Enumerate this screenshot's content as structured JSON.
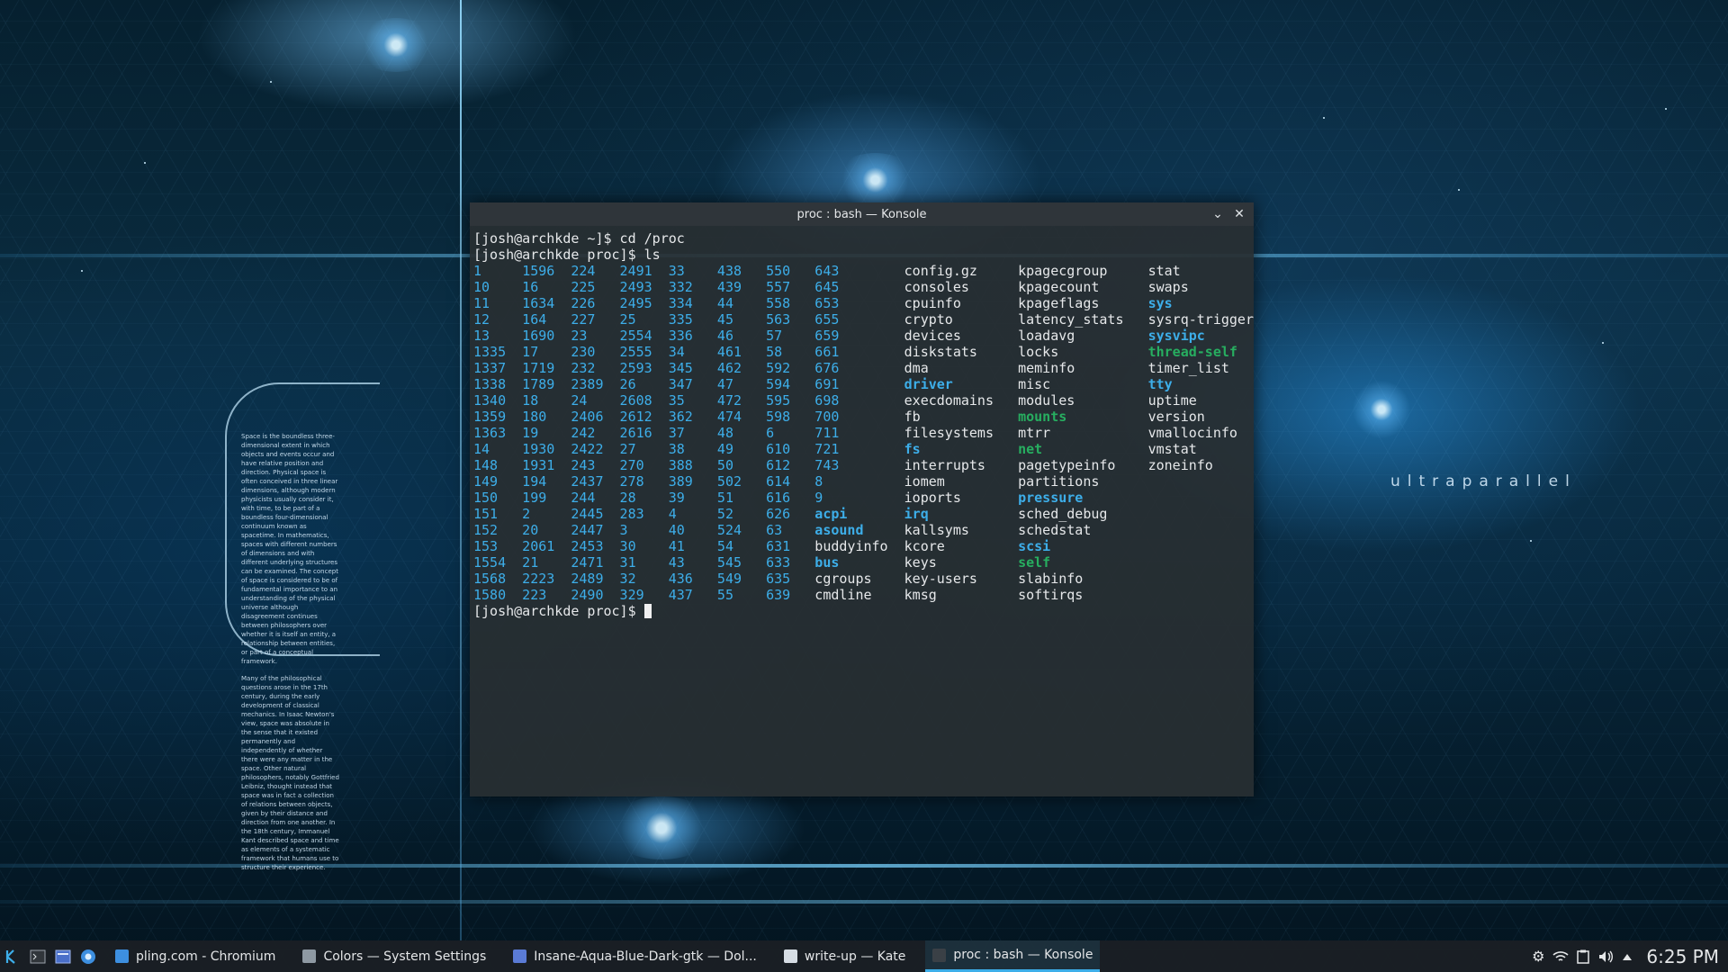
{
  "wallpaper": {
    "brand_text": "ultraparallel",
    "panel_paragraphs": [
      "Space is the boundless three-dimensional extent in which objects and events occur and have relative position and direction. Physical space is often conceived in three linear dimensions, although modern physicists usually consider it, with time, to be part of a boundless four-dimensional continuum known as spacetime. In mathematics, spaces with different numbers of dimensions and with different underlying structures can be examined. The concept of space is considered to be of fundamental importance to an understanding of the physical universe although disagreement continues between philosophers over whether it is itself an entity, a relationship between entities, or part of a conceptual framework.",
      "Many of the philosophical questions arose in the 17th century, during the early development of classical mechanics. In Isaac Newton's view, space was absolute in the sense that it existed permanently and independently of whether there were any matter in the space. Other natural philosophers, notably Gottfried Leibniz, thought instead that space was in fact a collection of relations between objects, given by their distance and direction from one another. In the 18th century, Immanuel Kant described space and time as elements of a systematic framework that humans use to structure their experience."
    ]
  },
  "konsole": {
    "title": "proc : bash — Konsole",
    "minimize_glyph": "⌄",
    "close_glyph": "✕",
    "lines": [
      [
        {
          "t": "[josh@archkde ~]$ cd /proc",
          "c": ""
        }
      ],
      [
        {
          "t": "[josh@archkde proc]$ ls",
          "c": ""
        }
      ],
      [
        {
          "t": "1     ",
          "c": "num"
        },
        {
          "t": "1596  224   2491  33    438   550   643        ",
          "c": "num"
        },
        {
          "t": "config.gz     ",
          "c": ""
        },
        {
          "t": "kpagecgroup     ",
          "c": ""
        },
        {
          "t": "stat",
          "c": ""
        }
      ],
      [
        {
          "t": "10    16    225   2493  332   439   557   645        ",
          "c": "num"
        },
        {
          "t": "consoles      ",
          "c": ""
        },
        {
          "t": "kpagecount      ",
          "c": ""
        },
        {
          "t": "swaps",
          "c": ""
        }
      ],
      [
        {
          "t": "11    1634  226   2495  334   44    558   653        ",
          "c": "num"
        },
        {
          "t": "cpuinfo       ",
          "c": ""
        },
        {
          "t": "kpageflags      ",
          "c": ""
        },
        {
          "t": "sys",
          "c": "dir"
        }
      ],
      [
        {
          "t": "12    164   227   25    335   45    563   655        ",
          "c": "num"
        },
        {
          "t": "crypto        ",
          "c": ""
        },
        {
          "t": "latency_stats   ",
          "c": ""
        },
        {
          "t": "sysrq-trigger",
          "c": ""
        }
      ],
      [
        {
          "t": "13    1690  23    2554  336   46    57    659        ",
          "c": "num"
        },
        {
          "t": "devices       ",
          "c": ""
        },
        {
          "t": "loadavg         ",
          "c": ""
        },
        {
          "t": "sysvipc",
          "c": "dir"
        }
      ],
      [
        {
          "t": "1335  17    230   2555  34    461   58    661        ",
          "c": "num"
        },
        {
          "t": "diskstats     ",
          "c": ""
        },
        {
          "t": "locks           ",
          "c": ""
        },
        {
          "t": "thread-self",
          "c": "lnk"
        }
      ],
      [
        {
          "t": "1337  1719  232   2593  345   462   592   676        ",
          "c": "num"
        },
        {
          "t": "dma           ",
          "c": ""
        },
        {
          "t": "meminfo         ",
          "c": ""
        },
        {
          "t": "timer_list",
          "c": ""
        }
      ],
      [
        {
          "t": "1338  1789  2389  26    347   47    594   691        ",
          "c": "num"
        },
        {
          "t": "driver",
          "c": "dir"
        },
        {
          "t": "        ",
          "c": ""
        },
        {
          "t": "misc            ",
          "c": ""
        },
        {
          "t": "tty",
          "c": "dir"
        }
      ],
      [
        {
          "t": "1340  18    24    2608  35    472   595   698        ",
          "c": "num"
        },
        {
          "t": "execdomains   ",
          "c": ""
        },
        {
          "t": "modules         ",
          "c": ""
        },
        {
          "t": "uptime",
          "c": ""
        }
      ],
      [
        {
          "t": "1359  180   2406  2612  362   474   598   700        ",
          "c": "num"
        },
        {
          "t": "fb            ",
          "c": ""
        },
        {
          "t": "mounts",
          "c": "lnk"
        },
        {
          "t": "          ",
          "c": ""
        },
        {
          "t": "version",
          "c": ""
        }
      ],
      [
        {
          "t": "1363  19    242   2616  37    48    6     711        ",
          "c": "num"
        },
        {
          "t": "filesystems   ",
          "c": ""
        },
        {
          "t": "mtrr            ",
          "c": ""
        },
        {
          "t": "vmallocinfo",
          "c": ""
        }
      ],
      [
        {
          "t": "14    1930  2422  27    38    49    610   721        ",
          "c": "num"
        },
        {
          "t": "fs",
          "c": "dir"
        },
        {
          "t": "            ",
          "c": ""
        },
        {
          "t": "net",
          "c": "lnk"
        },
        {
          "t": "             ",
          "c": ""
        },
        {
          "t": "vmstat",
          "c": ""
        }
      ],
      [
        {
          "t": "148   1931  243   270   388   50    612   743        ",
          "c": "num"
        },
        {
          "t": "interrupts    ",
          "c": ""
        },
        {
          "t": "pagetypeinfo    ",
          "c": ""
        },
        {
          "t": "zoneinfo",
          "c": ""
        }
      ],
      [
        {
          "t": "149   194   2437  278   389   502   614   8          ",
          "c": "num"
        },
        {
          "t": "iomem         ",
          "c": ""
        },
        {
          "t": "partitions",
          "c": ""
        }
      ],
      [
        {
          "t": "150   199   244   28    39    51    616   9          ",
          "c": "num"
        },
        {
          "t": "ioports       ",
          "c": ""
        },
        {
          "t": "pressure",
          "c": "dir"
        }
      ],
      [
        {
          "t": "151   2     2445  283   4     52    626   ",
          "c": "num"
        },
        {
          "t": "acpi",
          "c": "dir"
        },
        {
          "t": "       ",
          "c": ""
        },
        {
          "t": "irq",
          "c": "dir"
        },
        {
          "t": "           ",
          "c": ""
        },
        {
          "t": "sched_debug",
          "c": ""
        }
      ],
      [
        {
          "t": "152   20    2447  3     40    524   63    ",
          "c": "num"
        },
        {
          "t": "asound",
          "c": "dir"
        },
        {
          "t": "     ",
          "c": ""
        },
        {
          "t": "kallsyms      ",
          "c": ""
        },
        {
          "t": "schedstat",
          "c": ""
        }
      ],
      [
        {
          "t": "153   2061  2453  30    41    54    631   ",
          "c": "num"
        },
        {
          "t": "buddyinfo  ",
          "c": ""
        },
        {
          "t": "kcore         ",
          "c": ""
        },
        {
          "t": "scsi",
          "c": "dir"
        }
      ],
      [
        {
          "t": "1554  21    2471  31    43    545   633   ",
          "c": "num"
        },
        {
          "t": "bus",
          "c": "dir"
        },
        {
          "t": "        ",
          "c": ""
        },
        {
          "t": "keys          ",
          "c": ""
        },
        {
          "t": "self",
          "c": "lnk"
        }
      ],
      [
        {
          "t": "1568  2223  2489  32    436   549   635   ",
          "c": "num"
        },
        {
          "t": "cgroups    ",
          "c": ""
        },
        {
          "t": "key-users     ",
          "c": ""
        },
        {
          "t": "slabinfo",
          "c": ""
        }
      ],
      [
        {
          "t": "1580  223   2490  329   437   55    639   ",
          "c": "num"
        },
        {
          "t": "cmdline    ",
          "c": ""
        },
        {
          "t": "kmsg          ",
          "c": ""
        },
        {
          "t": "softirqs",
          "c": ""
        }
      ],
      [
        {
          "t": "[josh@archkde proc]$ ",
          "c": ""
        },
        {
          "t": "",
          "c": "cursor"
        }
      ]
    ]
  },
  "taskbar": {
    "launchers": [
      "kde-launcher-icon",
      "terminal-icon",
      "files-icon",
      "chromium-icon"
    ],
    "tasks": [
      {
        "label": "pling.com - Chromium",
        "icon": "chromium-icon",
        "color": "#3d8fe0",
        "active": false
      },
      {
        "label": "Colors — System Settings",
        "icon": "settings-icon",
        "color": "#8e99a3",
        "active": false
      },
      {
        "label": "Insane-Aqua-Blue-Dark-gtk — Dol...",
        "icon": "dolphin-icon",
        "color": "#5a7bd6",
        "active": false
      },
      {
        "label": "write-up — Kate",
        "icon": "kate-icon",
        "color": "#d6dde4",
        "active": false
      },
      {
        "label": "proc : bash — Konsole",
        "icon": "konsole-icon",
        "color": "#3a4046",
        "active": true
      }
    ],
    "tray_icons": [
      "gear-icon",
      "wifi-icon",
      "clipboard-icon",
      "volume-icon",
      "arrow-up-icon"
    ],
    "clock": "6:25 PM",
    "colors": {
      "accent": "#3daee9",
      "link": "#27ae60"
    }
  }
}
